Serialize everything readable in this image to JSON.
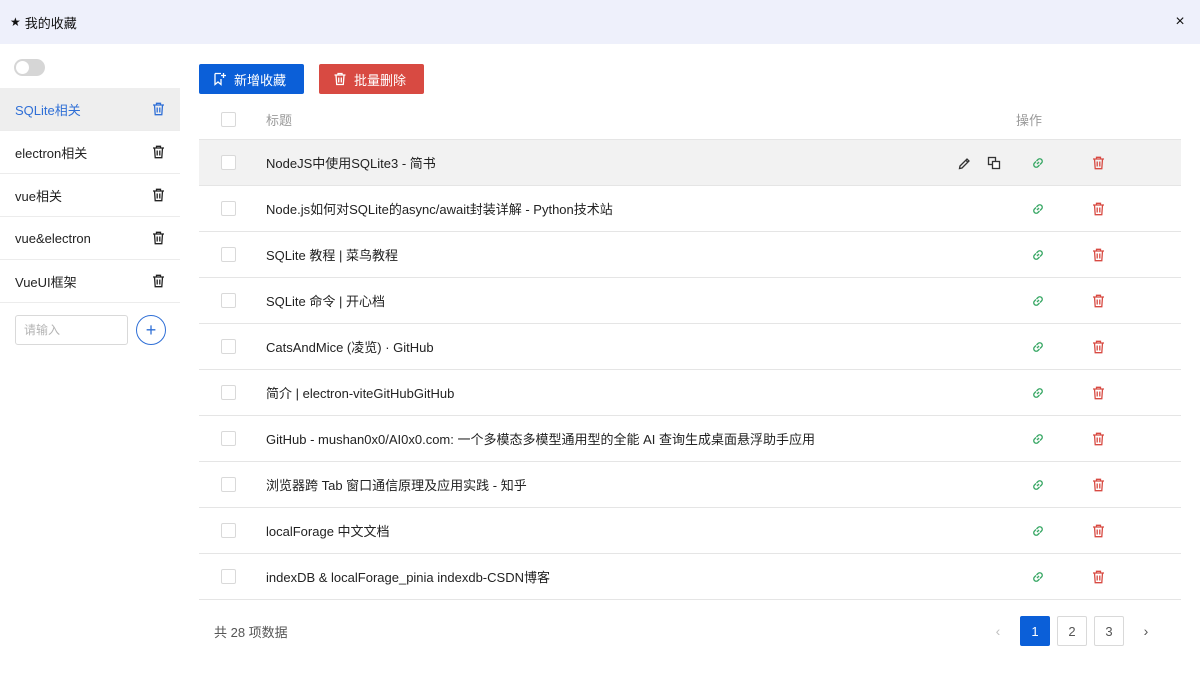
{
  "window": {
    "title": "我的收藏",
    "star": "★",
    "close": "×"
  },
  "sidebar": {
    "toggle_on": false,
    "categories": [
      {
        "label": "SQLite相关",
        "active": true
      },
      {
        "label": "electron相关",
        "active": false
      },
      {
        "label": "vue相关",
        "active": false
      },
      {
        "label": "vue&electron",
        "active": false
      },
      {
        "label": "VueUI框架",
        "active": false
      }
    ],
    "new_category_placeholder": "请输入",
    "add_label": "+"
  },
  "toolbar": {
    "add_label": "新增收藏",
    "batch_delete_label": "批量删除"
  },
  "table": {
    "columns": {
      "title": "标题",
      "actions": "操作"
    },
    "rows": [
      "NodeJS中使用SQLite3 - 简书",
      "Node.js如何对SQLite的async/await封装详解 - Python技术站",
      "SQLite 教程 | 菜鸟教程",
      "SQLite 命令 | 开心档",
      "CatsAndMice (凌览) · GitHub",
      "简介 | electron-viteGitHubGitHub",
      "GitHub - mushan0x0/AI0x0.com: 一个多模态多模型通用型的全能 AI 查询生成桌面悬浮助手应用",
      "浏览器跨 Tab 窗口通信原理及应用实践 - 知乎",
      "localForage 中文文档",
      "indexDB & localForage_pinia indexdb-CSDN博客"
    ]
  },
  "pagination": {
    "total_text": "共 28 项数据",
    "pages": [
      "1",
      "2",
      "3"
    ],
    "current": "1",
    "prev": "‹",
    "next": "›"
  },
  "colors": {
    "primary": "#0b5fd8",
    "danger": "#d84a42",
    "link": "#3aa866",
    "active_text": "#2f6fd6"
  }
}
